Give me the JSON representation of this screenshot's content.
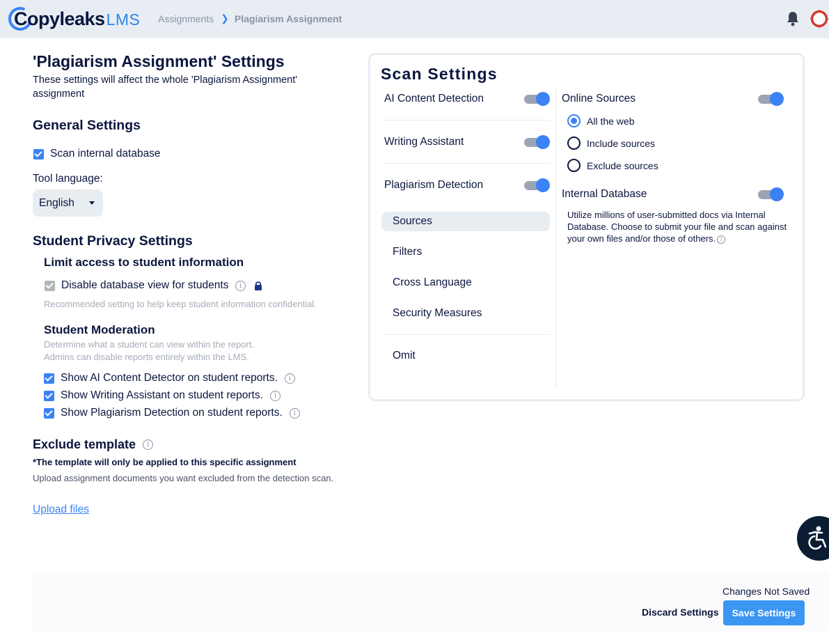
{
  "header": {
    "logo_text": "Copyleaks",
    "logo_suffix": "LMS",
    "breadcrumb": [
      "Assignments",
      "Plagiarism Assignment"
    ]
  },
  "left": {
    "title": "'Plagiarism Assignment' Settings",
    "subtitle": "These settings will affect the whole 'Plagiarism Assignment' assignment",
    "general": {
      "title": "General Settings",
      "scan_internal_db": "Scan internal database",
      "tool_language_label": "Tool language:",
      "tool_language_value": "English"
    },
    "privacy": {
      "title": "Student Privacy Settings",
      "limit_title": "Limit access to student information",
      "disable_db_view": "Disable database view for students",
      "recommended": "Recommended setting to help keep student information confidential.",
      "moderation_title": "Student Moderation",
      "moderation_desc_1": "Determine what a student can view within the report.",
      "moderation_desc_2": "Admins can disable reports entirely within the LMS.",
      "show_ai": "Show AI Content Detector on student reports.",
      "show_writing": "Show Writing Assistant on student reports.",
      "show_plagiarism": "Show Plagiarism Detection on student reports."
    },
    "exclude": {
      "title": "Exclude template",
      "note": "*The template will only be applied to this specific assignment",
      "desc": "Upload assignment documents you want excluded from the detection scan.",
      "upload_link": "Upload files"
    }
  },
  "scan": {
    "title": "Scan Settings",
    "ai_detection": "AI Content Detection",
    "writing_assistant": "Writing Assistant",
    "plagiarism_detection": "Plagiarism Detection",
    "nav": [
      "Sources",
      "Filters",
      "Cross Language",
      "Security Measures",
      "Omit"
    ],
    "online_sources": "Online Sources",
    "radio_options": [
      "All the web",
      "Include sources",
      "Exclude sources"
    ],
    "radio_selected": "All the web",
    "internal_database": "Internal Database",
    "internal_db_desc": "Utilize millions of user-submitted docs via Internal Database. Choose to submit your file and scan against your own files and/or those of others."
  },
  "footer": {
    "status": "Changes Not Saved",
    "discard": "Discard Settings",
    "save": "Save Settings"
  },
  "colors": {
    "accent": "#3b82f6",
    "navy": "#0b163e",
    "header_bg": "#e8edf4"
  }
}
